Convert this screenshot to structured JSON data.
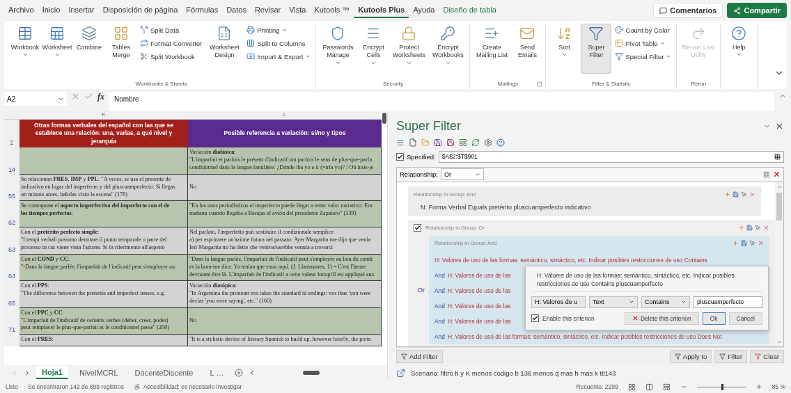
{
  "menu_tabs": [
    {
      "label": "Archivo",
      "selected": false,
      "kind": "normal"
    },
    {
      "label": "Inicio",
      "selected": false,
      "kind": "normal"
    },
    {
      "label": "Insertar",
      "selected": false,
      "kind": "normal"
    },
    {
      "label": "Disposición de página",
      "selected": false,
      "kind": "normal"
    },
    {
      "label": "Fórmulas",
      "selected": false,
      "kind": "normal"
    },
    {
      "label": "Datos",
      "selected": false,
      "kind": "normal"
    },
    {
      "label": "Revisar",
      "selected": false,
      "kind": "normal"
    },
    {
      "label": "Vista",
      "selected": false,
      "kind": "normal"
    },
    {
      "label": "Kutools ™",
      "selected": false,
      "kind": "normal"
    },
    {
      "label": "Kutools Plus",
      "selected": true,
      "kind": "normal"
    },
    {
      "label": "Ayuda",
      "selected": false,
      "kind": "normal"
    },
    {
      "label": "Diseño de tabla",
      "selected": false,
      "kind": "contextual"
    }
  ],
  "comments_button": "Comentarios",
  "share_button": "Compartir",
  "ribbon": {
    "groups": [
      {
        "label": "Workbooks & Sheets",
        "launcher": false,
        "items": [
          {
            "kind": "large",
            "label": "Workbook",
            "dropdown": true,
            "selected": false,
            "disabled": false
          },
          {
            "kind": "large",
            "label": "Worksheet",
            "dropdown": true,
            "selected": false,
            "disabled": false
          },
          {
            "kind": "large",
            "label": "Combine",
            "dropdown": false,
            "selected": false,
            "disabled": false
          },
          {
            "kind": "large",
            "label": "Tables Merge",
            "dropdown": false,
            "selected": false,
            "disabled": false
          },
          {
            "kind": "small",
            "label": "Split Data",
            "dropdown": false,
            "selected": false,
            "disabled": false
          },
          {
            "kind": "small",
            "label": "Format Converter",
            "dropdown": false,
            "selected": false,
            "disabled": false
          },
          {
            "kind": "small",
            "label": "Split Workbook",
            "dropdown": false,
            "selected": false,
            "disabled": false
          },
          {
            "kind": "large",
            "label": "Worksheet Design",
            "dropdown": false,
            "selected": false,
            "disabled": false
          },
          {
            "kind": "small",
            "label": "Printing",
            "dropdown": true,
            "selected": false,
            "disabled": false
          },
          {
            "kind": "small",
            "label": "Split to Columns",
            "dropdown": false,
            "selected": false,
            "disabled": false
          },
          {
            "kind": "small",
            "label": "Import & Export",
            "dropdown": true,
            "selected": false,
            "disabled": false
          }
        ]
      },
      {
        "label": "Security",
        "launcher": false,
        "items": [
          {
            "kind": "large",
            "label": "Passwords Manage",
            "dropdown": true,
            "selected": false,
            "disabled": false
          },
          {
            "kind": "large",
            "label": "Encrypt Cells",
            "dropdown": true,
            "selected": false,
            "disabled": false
          },
          {
            "kind": "large",
            "label": "Protect Worksheets",
            "dropdown": true,
            "selected": false,
            "disabled": false
          },
          {
            "kind": "large",
            "label": "Encrypt Workbooks",
            "dropdown": true,
            "selected": false,
            "disabled": false
          }
        ]
      },
      {
        "label": "Mailings",
        "launcher": true,
        "items": [
          {
            "kind": "large",
            "label": "Create Mailing List",
            "dropdown": false,
            "selected": false,
            "disabled": false
          },
          {
            "kind": "large",
            "label": "Send Emails",
            "dropdown": false,
            "selected": false,
            "disabled": false
          }
        ]
      },
      {
        "label": "Filter & Statistic",
        "launcher": false,
        "items": [
          {
            "kind": "large",
            "label": "Sort",
            "dropdown": true,
            "selected": false,
            "disabled": false
          },
          {
            "kind": "large",
            "label": "Super Filter",
            "dropdown": false,
            "selected": true,
            "disabled": false
          },
          {
            "kind": "small",
            "label": "Count by Color",
            "dropdown": false,
            "selected": false,
            "disabled": false
          },
          {
            "kind": "small",
            "label": "Pivot Table",
            "dropdown": true,
            "selected": false,
            "disabled": false
          },
          {
            "kind": "small",
            "label": "Special Filter",
            "dropdown": true,
            "selected": false,
            "disabled": false
          }
        ]
      },
      {
        "label": "Rerun",
        "launcher": false,
        "items": [
          {
            "kind": "large",
            "label": "Re-run Last Utility",
            "dropdown": false,
            "selected": false,
            "disabled": true
          }
        ]
      },
      {
        "launcher": false,
        "items": [
          {
            "kind": "large",
            "label": "Help",
            "dropdown": true,
            "selected": false,
            "disabled": false
          }
        ]
      }
    ]
  },
  "formula_bar": {
    "cell": "A2",
    "function_label": "fx",
    "value": "Nombre"
  },
  "sheet": {
    "columns": [
      "K",
      "L"
    ],
    "header": {
      "number": "2",
      "k": "Otras formas verbales del español con las que se establece una relación: una, varias, a qué nivel y jerarquía",
      "l": "Posible referencia a variación: sí/no y tipos"
    },
    "rows": [
      {
        "number": "14",
        "l": [
          "Variación **diafásica**:",
          "\"L'imparfait et parfois le présent d'indicatif ont parfois le sens de plus-que-parfa",
          "conditionnel dans la langue familière: ¿Dónde iba yo a ir (=iría yo)? / Où irais-je"
        ]
      },
      {
        "number": "55",
        "k": [
          "Se relacionan **PRES**, **IMP** y **PPL**: \"A veces, se usa el presente de",
          "indicativo en lugar del imperfecto y del pluscuamperfecto: Si llegas",
          "un minuto antes, habrías visto la escena\" (176)"
        ],
        "l": [
          "No"
        ]
      },
      {
        "number": "62",
        "k": [
          "Se contrapone el **aspecto imperfectivo del imperfecto con el de**",
          "**los tiempos perfectos**:"
        ],
        "l": [
          "\"En los usos periodísticos el imperfecto puede llegar a tener valor narrativo: Era",
          "mañana cuando llegaba a Barajas el avión del presidente Zapatero\" (339)"
        ]
      },
      {
        "number": "63",
        "k": [
          "Con el **pretérito perfecto simple**:",
          "\"I tempi verbali possono denotare il punto temporale o parte del",
          "processo in cui viene vista l'azione. Si fa riferimento all'aspetto"
        ],
        "l": [
          "Nel parlato, l'imperfetto può sostituire il condizionale semplice:",
          "a) per esprimere un'azione futura nel passato: Ayer Margarita me dijo que venía",
          "Ieri Margarita mi ha detto che veniva/sarebbe venuta a trovarci"
        ]
      },
      {
        "number": "64",
        "k": [
          "Con el **COND** y **CC**:",
          "\"-Dans la langue parlée, l'imparfait de l'indicatif peut s'employer au"
        ],
        "l": [
          "\"Dans la langue parlée, l'imparfait de l'indicatif peut s'employer au lieu du condi",
          "es la hora-me dice. Ya tenían que estar aquí. (J. Llamazares, 1) = C'est l'heure",
          "devraient être là. L'imparfait de l'indicatif a cette valeur lorsqu'il est appliqué aux"
        ]
      },
      {
        "number": "65",
        "k": [
          "Con el **PPS**:",
          "\"The difference between the preterite and imperfect tenses, e.g."
        ],
        "l": [
          "Variación **diatópica**:",
          "\"In Argentina the pronoun vos takes the standard tú endings: vos ibas 'you were",
          "decías 'you were saying', etc.\" (160)"
        ]
      },
      {
        "number": "71",
        "k": [
          "Con el **PPC** y **CC**:",
          "\"L'imparfait de l'indicatif de certains verbes (deber, creer, poder)",
          "peut remplacer le plus-que-parfait et le conditionnel passé\" (200)"
        ],
        "l": [
          "No"
        ]
      },
      {
        "k": [
          "Con el **PRES**:"
        ],
        "l": [
          "\"It is a stylistic device of literary Spanish to build up, however briefly, the pictu"
        ]
      }
    ]
  },
  "sheet_tabs": [
    {
      "label": "Hoja1",
      "selected": true
    },
    {
      "label": "NivelMCRL",
      "selected": false
    },
    {
      "label": "DocenteDiscente",
      "selected": false
    },
    {
      "label": "L …",
      "selected": false
    }
  ],
  "super_filter": {
    "title": "Super Filter",
    "specified": {
      "label": "Specified:",
      "checked": true,
      "value": "$A$2:$T$901"
    },
    "relationship": {
      "label": "Relationship:",
      "value": "Or"
    },
    "groups": [
      {
        "header": "Relationship in Group:  And",
        "checked": false,
        "criteria": [
          {
            "text": "N: Forma Verbal  Equals  pretérito pluscuamperfecto indicativo"
          }
        ]
      },
      {
        "header": "Relationship in Group:  Or",
        "checked": true,
        "side_label": "Or",
        "subgroup": {
          "header": "Relationship in Group:  And",
          "criteria": [
            {
              "text": "H: Valores de uso de las formas: semántico, sintáctico, etc. Indicar posibles restricciones de uso  Contains"
            },
            {
              "connector": "And",
              "text": "H: Valores de uso de las"
            },
            {
              "connector": "And",
              "text": "H: Valores de uso de las"
            },
            {
              "connector": "And",
              "text": "H: Valores de uso de las"
            },
            {
              "connector": "And",
              "text": "H: Valores de uso de las"
            },
            {
              "connector": "And",
              "text": "H: Valores de uso de las formas: semántico, sintáctico, etc. Indicar posibles restricciones de uso  Does Not"
            }
          ]
        }
      }
    ],
    "editor": {
      "summary": "H: Valores de uso de las formas: semántico, sintáctico, etc. Indicar posibles restricciones de uso  Contains  pluscuamperfecto",
      "column": "H: Valores de u",
      "type": "Text",
      "operator": "Contains",
      "value": "pluscuamperfecto",
      "enable_label": "Enable this criterion",
      "enabled": true,
      "delete_button": "Delete this criterion",
      "ok_button": "Ok",
      "cancel_button": "Cancel"
    },
    "add_button": "Add Filter",
    "apply_button": "Apply to",
    "filter_button": "Filter",
    "clear_button": "Clear",
    "scenario": "Scenario:  filtro h y K menos codigo b 136 menos q mas h mas k ttl143"
  },
  "status_bar": {
    "ready": "Listo",
    "message": "Se encontraron 142 de 899 registros",
    "accessibility": "Accesibilidad: es necesario investigar",
    "count": "Recuento: 2299",
    "zoom": {
      "level": 0.5,
      "label": "85 %"
    }
  }
}
